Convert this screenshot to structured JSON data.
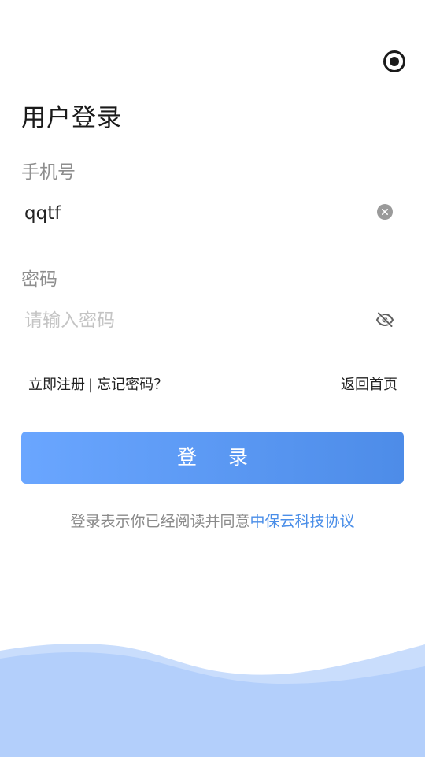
{
  "header": {
    "title": "用户登录",
    "record_icon": "record-icon"
  },
  "phone": {
    "label": "手机号",
    "value": "qqtf",
    "clear_icon": "clear-icon"
  },
  "password": {
    "label": "密码",
    "placeholder": "请输入密码",
    "toggle_icon": "eye-off-icon"
  },
  "links": {
    "register": "立即注册",
    "separator": "|",
    "forgot": "忘记密码？",
    "home": "返回首页"
  },
  "login_button": "登 录",
  "agreement": {
    "prefix": "登录表示你已经阅读并同意",
    "link": "中保云科技协议"
  },
  "colors": {
    "accent": "#4d8ce8",
    "link": "#4a8ee8",
    "wave": "#b5d0fb"
  }
}
